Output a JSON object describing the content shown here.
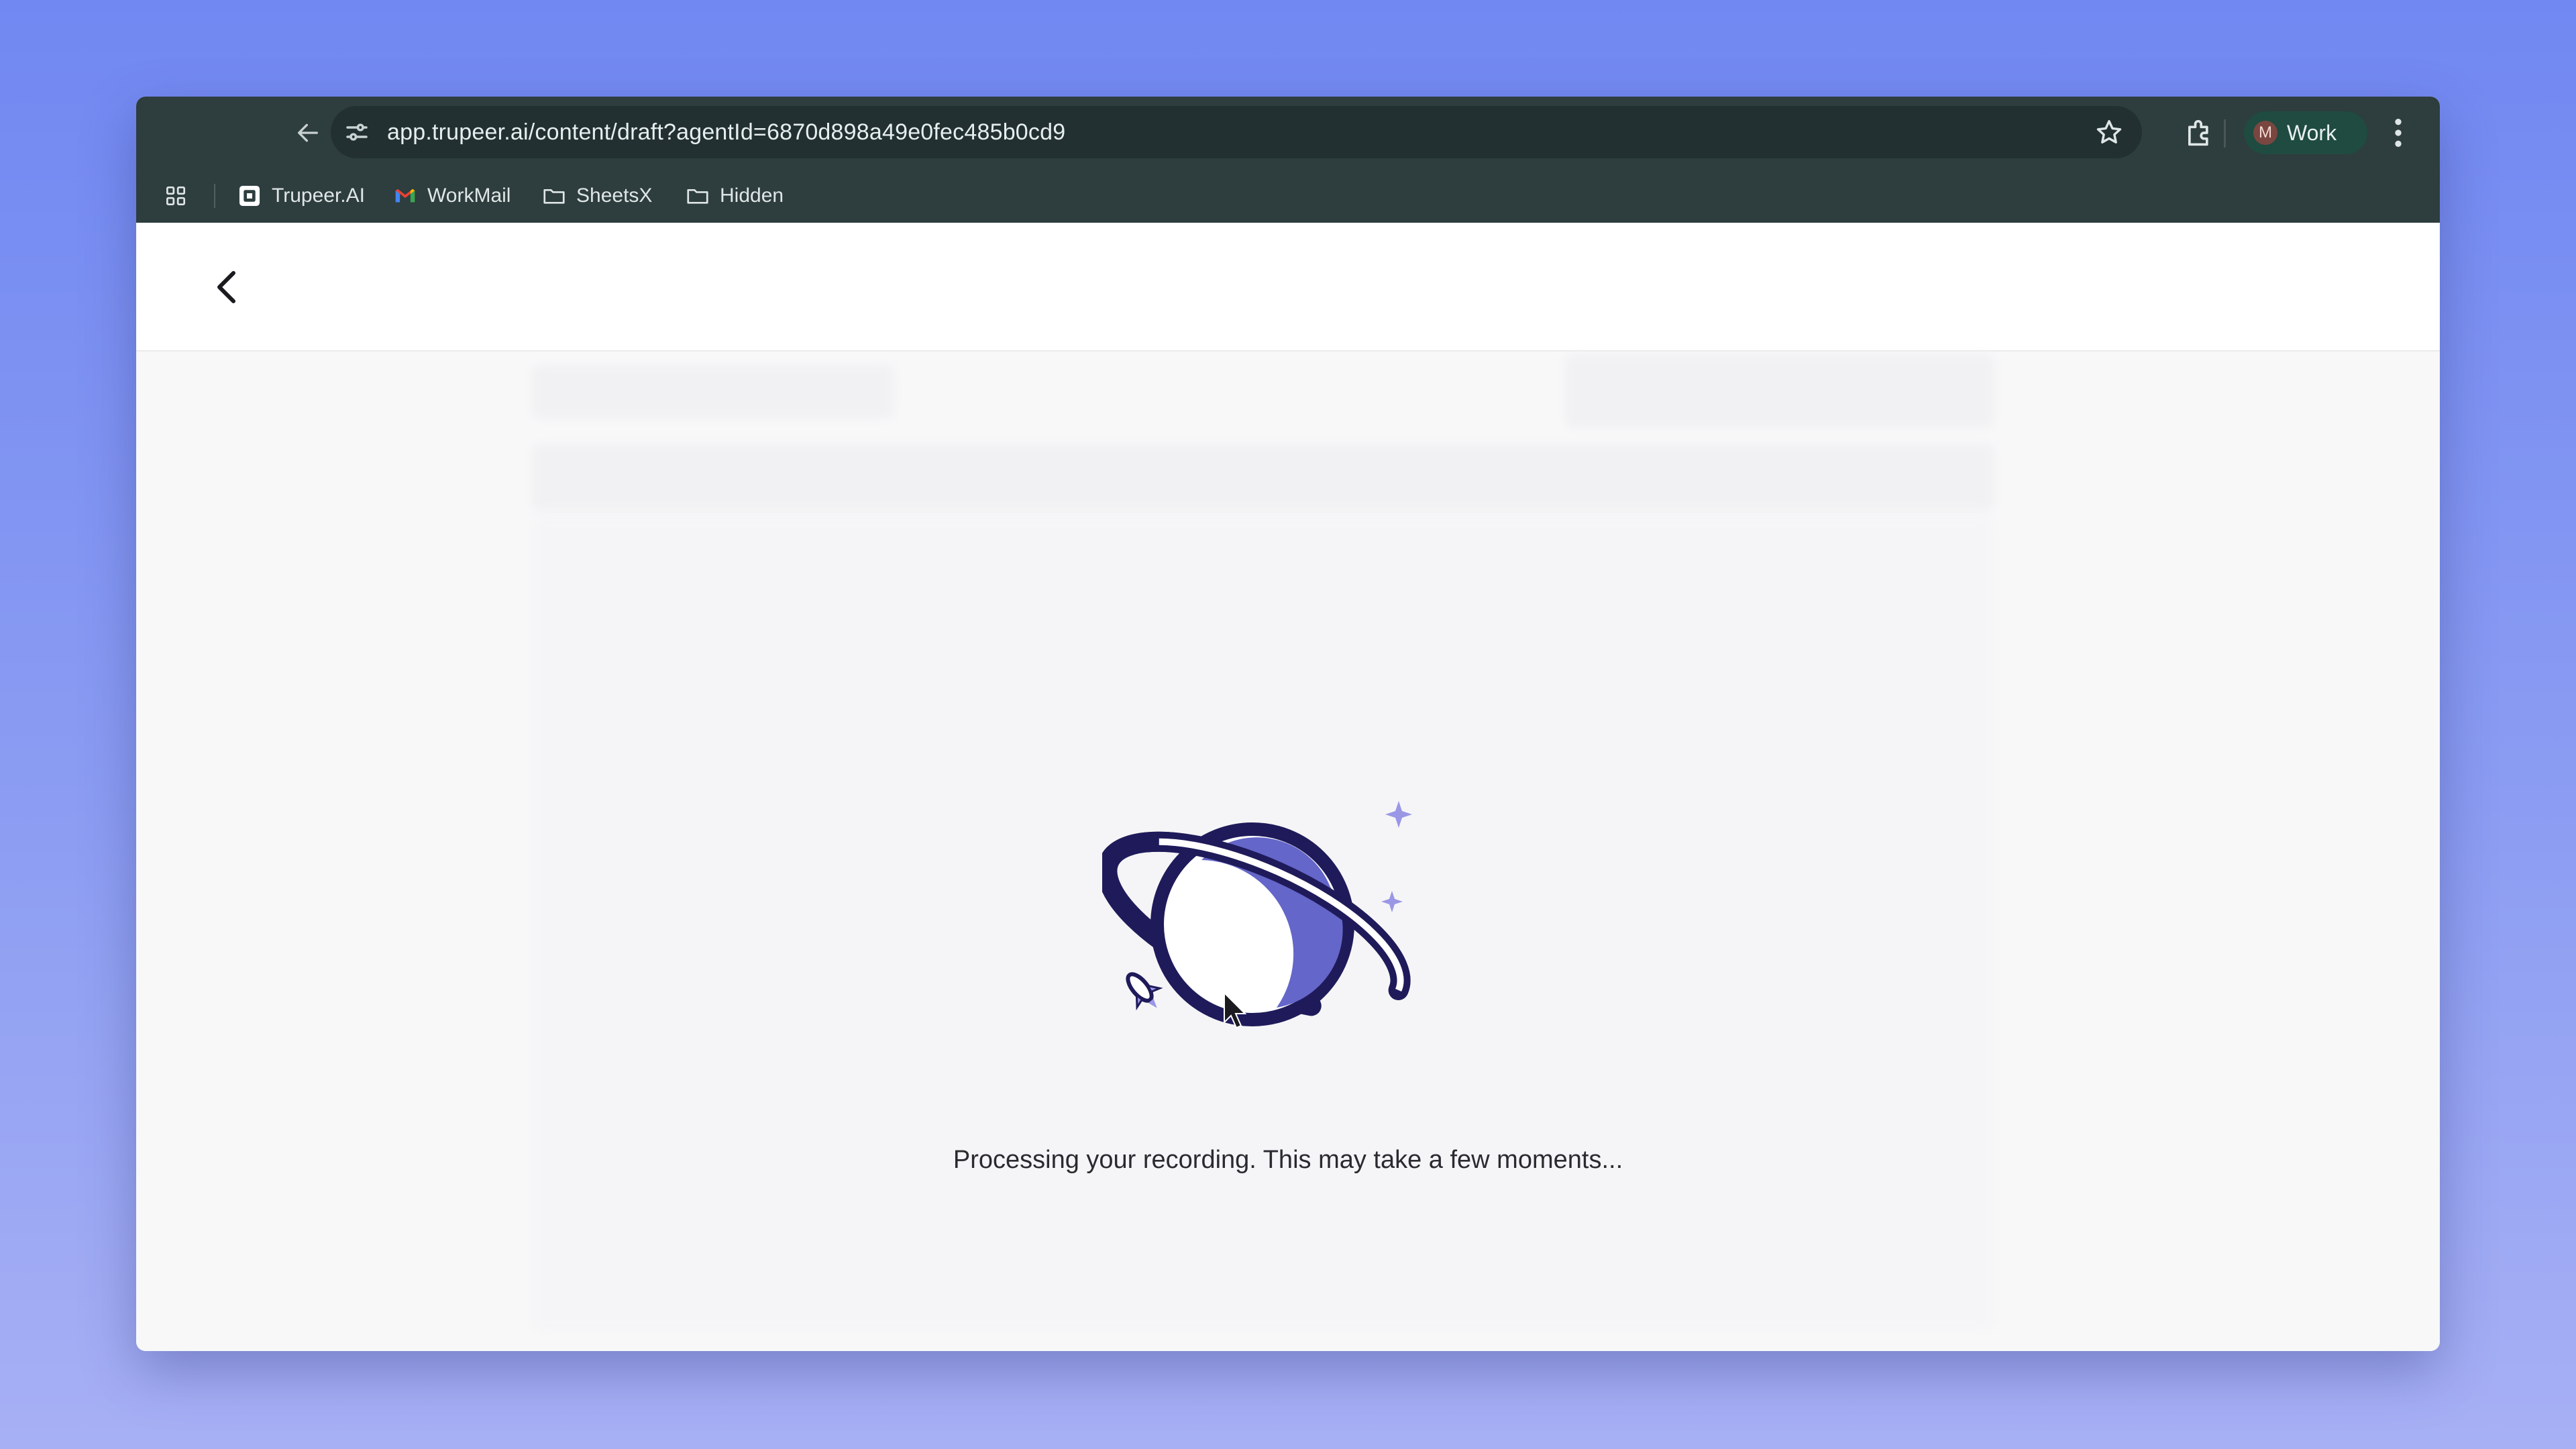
{
  "browser": {
    "url": "app.trupeer.ai/content/draft?agentId=6870d898a49e0fec485b0cd9",
    "profile": {
      "initial": "M",
      "name": "Work"
    },
    "bookmarks": [
      {
        "label": "Trupeer.AI",
        "icon": "trupeer-logo-icon"
      },
      {
        "label": "WorkMail",
        "icon": "gmail-icon"
      },
      {
        "label": "SheetsX",
        "icon": "folder-icon"
      },
      {
        "label": "Hidden",
        "icon": "folder-icon"
      }
    ],
    "colors": {
      "toolbar": "#2e3d3e",
      "omnibox": "#223031",
      "profile_chip": "#1f4b41"
    }
  },
  "page": {
    "status_message": "Processing your recording. This may take a few moments...",
    "illustration": "planet-with-rocket",
    "colors": {
      "planet": "#6466c9",
      "outline": "#1f1b5a",
      "sparkle": "#9a97e6",
      "background": "#f8f8f9"
    }
  }
}
